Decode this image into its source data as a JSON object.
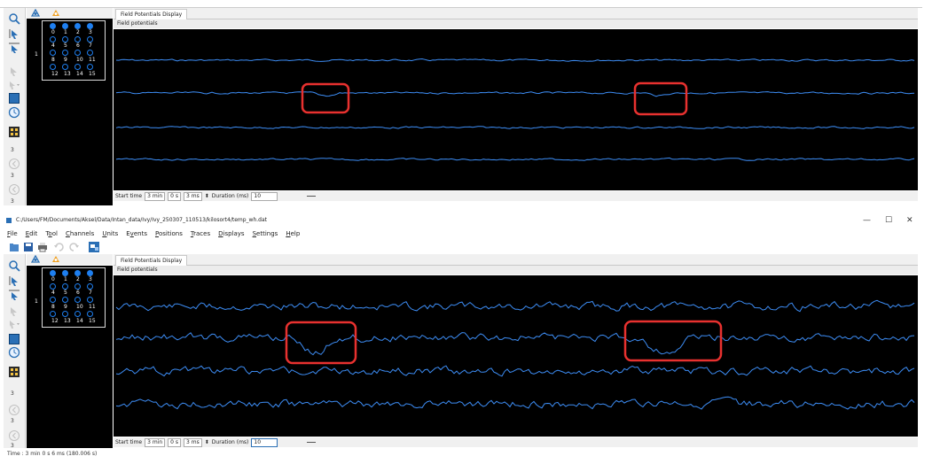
{
  "top_window": {
    "tab_label": "Field Potentials Display",
    "panel_title": "Field potentials",
    "start_time_label": "Start time",
    "start_min": "3 min",
    "start_s": "0 s",
    "start_ms": "3 ms",
    "duration_label": "Duration (ms)",
    "duration_value": "10",
    "map_row_label": "1",
    "side_labels": [
      "3",
      "3",
      "3"
    ]
  },
  "bottom_window": {
    "window_title": "C:/Users/FM/Documents/Aksel/Data/Intan_data/Ivy/Ivy_250307_110513/kilosort4/temp_wh.dat",
    "menu": [
      "File",
      "Edit",
      "Tool",
      "Channels",
      "Units",
      "Events",
      "Positions",
      "Traces",
      "Displays",
      "Settings",
      "Help"
    ],
    "menu_mnemonics": [
      "F",
      "E",
      "o",
      "C",
      "U",
      "v",
      "P",
      "T",
      "D",
      "S",
      "H"
    ],
    "tab_label": "Field Potentials Display",
    "panel_title": "Field potentials",
    "start_time_label": "Start time",
    "start_min": "3 min",
    "start_s": "0 s",
    "start_ms": "3 ms",
    "duration_label": "Duration (ms)",
    "duration_value": "10",
    "map_row_label": "1",
    "side_labels": [
      "3",
      "3",
      "3"
    ],
    "status_text": "Time : 3 min 0 s 6 ms (180.006 s)",
    "window_controls": [
      "—",
      "☐",
      "✕"
    ]
  },
  "electrode_labels": [
    "0",
    "1",
    "2",
    "3",
    "4",
    "5",
    "6",
    "7",
    "8",
    "9",
    "10",
    "11",
    "12",
    "13",
    "14",
    "15"
  ],
  "top_electrode_last_row": [
    "12",
    "13",
    "14",
    "15"
  ],
  "colors": {
    "trace": "#3d8df5",
    "background": "#000000",
    "highlight": "#e8312f",
    "electrode": "#1e7ff0"
  },
  "icons": {
    "toolbar": [
      "zoom-icon",
      "select-arrow-icon",
      "zoom-region-icon",
      "disabled-arrow-icon",
      "dropdown-arrow-icon",
      "layout-icon",
      "clock-icon",
      "grid-icon",
      "back-icon",
      "forward-icon"
    ],
    "file_toolbar": [
      "open-folder-icon",
      "save-icon",
      "print-icon",
      "undo-icon",
      "redo-icon",
      "window-icon"
    ],
    "header": [
      "probe-icon",
      "cluster-icon"
    ]
  }
}
